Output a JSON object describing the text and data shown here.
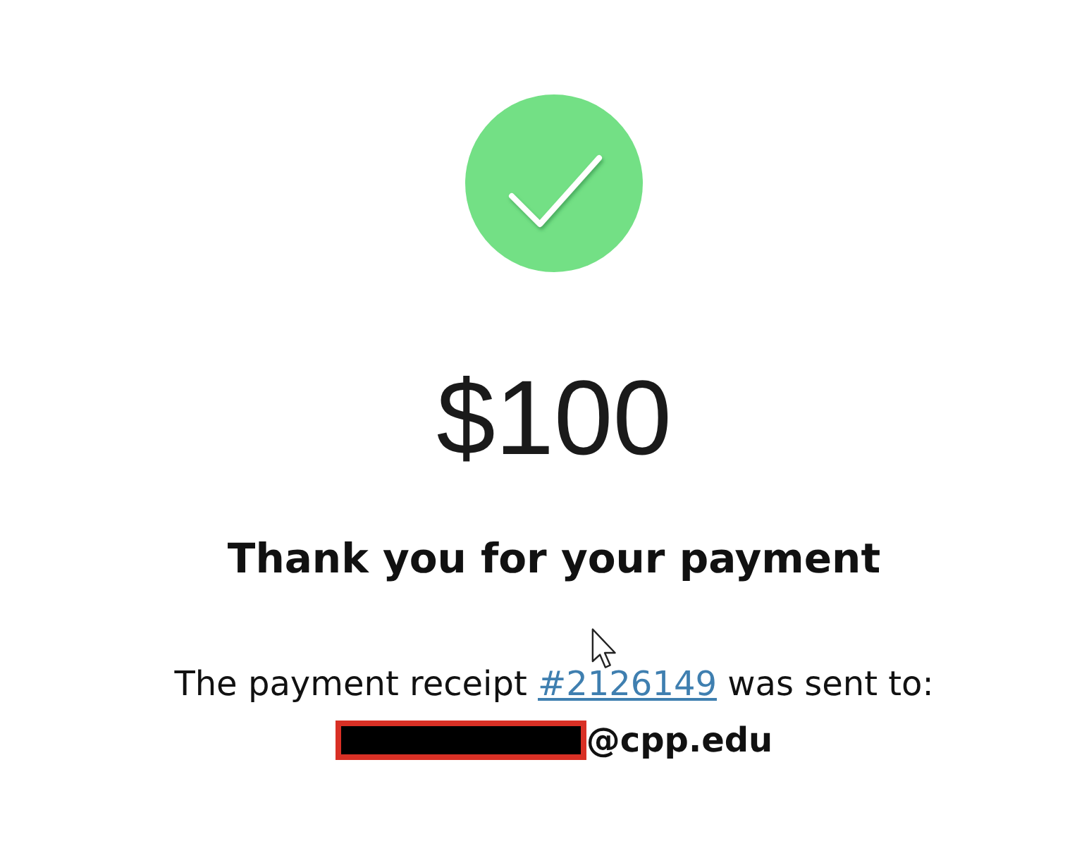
{
  "amount": "$100",
  "title": "Thank you for your payment",
  "receipt": {
    "prefix": "The payment receipt",
    "link": "#2126149",
    "suffix": "was sent to:"
  },
  "email": {
    "text": "@cpp.edu",
    "redacted": true
  }
}
